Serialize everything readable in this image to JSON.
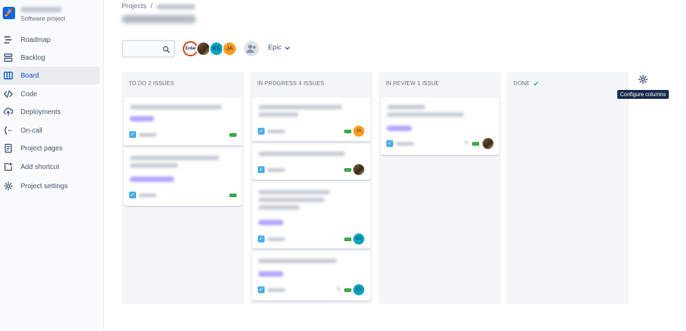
{
  "sidebar": {
    "project_type": "Software project",
    "items": [
      {
        "label": "Roadmap",
        "icon": "roadmap-icon"
      },
      {
        "label": "Backlog",
        "icon": "backlog-icon"
      },
      {
        "label": "Board",
        "icon": "board-icon",
        "active": true
      },
      {
        "label": "Code",
        "icon": "code-icon"
      },
      {
        "label": "Deployments",
        "icon": "deployments-icon"
      },
      {
        "label": "On-call",
        "icon": "on-call-icon"
      },
      {
        "label": "Project pages",
        "icon": "project-pages-icon"
      },
      {
        "label": "Add shortcut",
        "icon": "add-shortcut-icon"
      },
      {
        "label": "Project settings",
        "icon": "gear-icon"
      }
    ]
  },
  "breadcrumb": {
    "root": "Projects",
    "sep": "/"
  },
  "toolbar": {
    "avatars": [
      {
        "label": "Erdal",
        "kind": "logo"
      },
      {
        "label": "",
        "kind": "photo"
      },
      {
        "label": "KS",
        "kind": "initials"
      },
      {
        "label": "JA",
        "kind": "initials"
      }
    ],
    "epic_label": "Epic"
  },
  "columns": [
    {
      "title": "TO DO 2 ISSUES",
      "done_check": false
    },
    {
      "title": "IN PROGRESS 4 ISSUES",
      "done_check": false
    },
    {
      "title": "IN REVIEW 1 ISSUE",
      "done_check": false
    },
    {
      "title": "DONE",
      "done_check": true
    }
  ],
  "avatar_initials": {
    "ja": "JA",
    "ks": "KS"
  },
  "tooltip": "Configure columns",
  "colors": {
    "accent": "#0052cc",
    "column_bg": "#f4f5f7",
    "ks": "#00a3bf",
    "ja": "#ff991f",
    "priority": "#3cb64a"
  }
}
